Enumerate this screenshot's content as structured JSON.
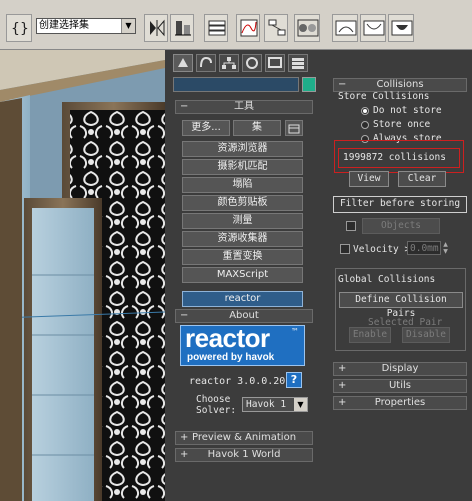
{
  "toolbar": {
    "selection_set_value": "创建选择集",
    "icons": [
      "curly-brace-icon",
      "mirror-icon",
      "align-icon",
      "layer-icon",
      "curve-editor-icon",
      "schematic-icon",
      "material-editor-icon",
      "render-setup-icon",
      "render-frame-icon",
      "quick-render-icon"
    ]
  },
  "command_panel": {
    "tab_icons": [
      "create-tab-icon",
      "modify-tab-icon",
      "hierarchy-tab-icon",
      "motion-tab-icon",
      "display-tab-icon",
      "utilities-tab-icon"
    ],
    "tools_header": "工具",
    "more_button": "更多...",
    "sets_button": "集",
    "tool_buttons": [
      "资源浏览器",
      "摄影机匹配",
      "塌陷",
      "颜色剪贴板",
      "测量",
      "资源收集器",
      "重置变换",
      "MAXScript",
      "reactor"
    ],
    "about_header": "About",
    "logo_main": "reactor",
    "logo_tm": "™",
    "logo_sub": "powered by havok",
    "version": "reactor 3.0.0.20",
    "help_button": "?",
    "choose_solver_label_1": "Choose",
    "choose_solver_label_2": "Solver:",
    "solver_value": "Havok 1",
    "preview_header": "Preview & Animation",
    "havok_world_header": "Havok 1 World"
  },
  "collisions": {
    "header": "Collisions",
    "store_group": "Store Collisions",
    "options": [
      "Do not store",
      "Store once",
      "Always store"
    ],
    "selected_option": 0,
    "collision_count": "1999872 collisions",
    "view_button": "View",
    "clear_button": "Clear",
    "filter_button": "Filter before storing",
    "objects_button": "Objects",
    "velocity_label": "Velocity >",
    "velocity_value": "0.0mm",
    "global_group": "Global Collisions",
    "define_pairs_button": "Define Collision Pairs",
    "selected_pair_label": "Selected Pair",
    "enable_button": "Enable",
    "disable_button": "Disable",
    "display_header": "Display",
    "utils_header": "Utils",
    "properties_header": "Properties"
  },
  "colors": {
    "highlight_box": "#cc2020",
    "reactor_blue": "#1f6fc1",
    "selected_tool": "#2f5d8a",
    "color_swatch": "#1fae8a"
  }
}
